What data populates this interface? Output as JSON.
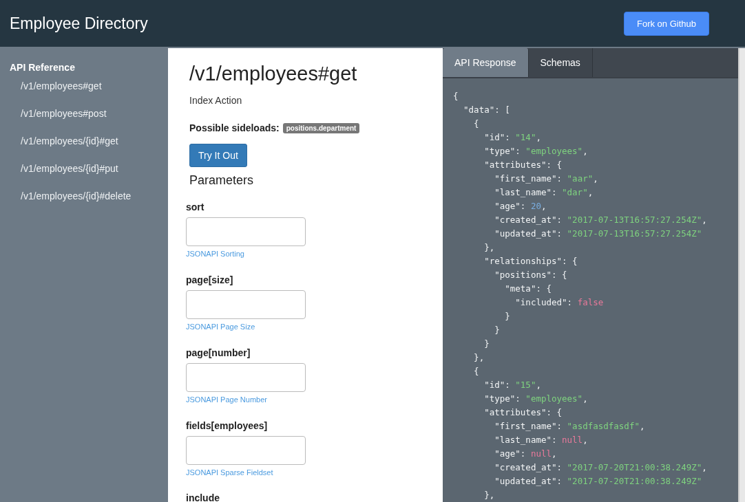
{
  "header": {
    "title": "Employee Directory",
    "button": "Fork on Github"
  },
  "sidebar": {
    "heading": "API Reference",
    "items": [
      {
        "label": "/v1/employees#get"
      },
      {
        "label": "/v1/employees#post"
      },
      {
        "label": "/v1/employees/{id}#get"
      },
      {
        "label": "/v1/employees/{id}#put"
      },
      {
        "label": "/v1/employees/{id}#delete"
      }
    ]
  },
  "endpoint": {
    "title": "/v1/employees#get",
    "description": "Index Action",
    "sideloads_label": "Possible sideloads:",
    "sideloads": [
      "positions.department"
    ],
    "try_button": "Try It Out",
    "parameters_heading": "Parameters",
    "parameters": [
      {
        "name": "sort",
        "help": "JSONAPI Sorting"
      },
      {
        "name": "page[size]",
        "help": "JSONAPI Page Size"
      },
      {
        "name": "page[number]",
        "help": "JSONAPI Page Number"
      },
      {
        "name": "fields[employees]",
        "help": "JSONAPI Sparse Fieldset"
      },
      {
        "name": "include"
      }
    ]
  },
  "response": {
    "tabs": [
      {
        "label": "API Response",
        "selected": true
      },
      {
        "label": "Schemas",
        "selected": false
      }
    ],
    "lines": [
      [
        {
          "text": "{",
          "kind": "plain"
        }
      ],
      [
        {
          "text": "  \"data\": [",
          "kind": "plain"
        }
      ],
      [
        {
          "text": "    {",
          "kind": "plain"
        }
      ],
      [
        {
          "text": "      \"id\": ",
          "kind": "plain"
        },
        {
          "text": "\"14\"",
          "kind": "string"
        },
        {
          "text": ",",
          "kind": "plain"
        }
      ],
      [
        {
          "text": "      \"type\": ",
          "kind": "plain"
        },
        {
          "text": "\"employees\"",
          "kind": "string"
        },
        {
          "text": ",",
          "kind": "plain"
        }
      ],
      [
        {
          "text": "      \"attributes\": {",
          "kind": "plain"
        }
      ],
      [
        {
          "text": "        \"first_name\": ",
          "kind": "plain"
        },
        {
          "text": "\"aar\"",
          "kind": "string"
        },
        {
          "text": ",",
          "kind": "plain"
        }
      ],
      [
        {
          "text": "        \"last_name\": ",
          "kind": "plain"
        },
        {
          "text": "\"dar\"",
          "kind": "string"
        },
        {
          "text": ",",
          "kind": "plain"
        }
      ],
      [
        {
          "text": "        \"age\": ",
          "kind": "plain"
        },
        {
          "text": "20",
          "kind": "number"
        },
        {
          "text": ",",
          "kind": "plain"
        }
      ],
      [
        {
          "text": "        \"created_at\": ",
          "kind": "plain"
        },
        {
          "text": "\"2017-07-13T16:57:27.254Z\"",
          "kind": "string"
        },
        {
          "text": ",",
          "kind": "plain"
        }
      ],
      [
        {
          "text": "        \"updated_at\": ",
          "kind": "plain"
        },
        {
          "text": "\"2017-07-13T16:57:27.254Z\"",
          "kind": "string"
        }
      ],
      [
        {
          "text": "      },",
          "kind": "plain"
        }
      ],
      [
        {
          "text": "      \"relationships\": {",
          "kind": "plain"
        }
      ],
      [
        {
          "text": "        \"positions\": {",
          "kind": "plain"
        }
      ],
      [
        {
          "text": "          \"meta\": {",
          "kind": "plain"
        }
      ],
      [
        {
          "text": "            \"included\": ",
          "kind": "plain"
        },
        {
          "text": "false",
          "kind": "literal"
        }
      ],
      [
        {
          "text": "          }",
          "kind": "plain"
        }
      ],
      [
        {
          "text": "        }",
          "kind": "plain"
        }
      ],
      [
        {
          "text": "      }",
          "kind": "plain"
        }
      ],
      [
        {
          "text": "    },",
          "kind": "plain"
        }
      ],
      [
        {
          "text": "    {",
          "kind": "plain"
        }
      ],
      [
        {
          "text": "      \"id\": ",
          "kind": "plain"
        },
        {
          "text": "\"15\"",
          "kind": "string"
        },
        {
          "text": ",",
          "kind": "plain"
        }
      ],
      [
        {
          "text": "      \"type\": ",
          "kind": "plain"
        },
        {
          "text": "\"employees\"",
          "kind": "string"
        },
        {
          "text": ",",
          "kind": "plain"
        }
      ],
      [
        {
          "text": "      \"attributes\": {",
          "kind": "plain"
        }
      ],
      [
        {
          "text": "        \"first_name\": ",
          "kind": "plain"
        },
        {
          "text": "\"asdfasdfasdf\"",
          "kind": "string"
        },
        {
          "text": ",",
          "kind": "plain"
        }
      ],
      [
        {
          "text": "        \"last_name\": ",
          "kind": "plain"
        },
        {
          "text": "null",
          "kind": "literal"
        },
        {
          "text": ",",
          "kind": "plain"
        }
      ],
      [
        {
          "text": "        \"age\": ",
          "kind": "plain"
        },
        {
          "text": "null",
          "kind": "literal"
        },
        {
          "text": ",",
          "kind": "plain"
        }
      ],
      [
        {
          "text": "        \"created_at\": ",
          "kind": "plain"
        },
        {
          "text": "\"2017-07-20T21:00:38.249Z\"",
          "kind": "string"
        },
        {
          "text": ",",
          "kind": "plain"
        }
      ],
      [
        {
          "text": "        \"updated_at\": ",
          "kind": "plain"
        },
        {
          "text": "\"2017-07-20T21:00:38.249Z\"",
          "kind": "string"
        }
      ],
      [
        {
          "text": "      },",
          "kind": "plain"
        }
      ]
    ]
  }
}
